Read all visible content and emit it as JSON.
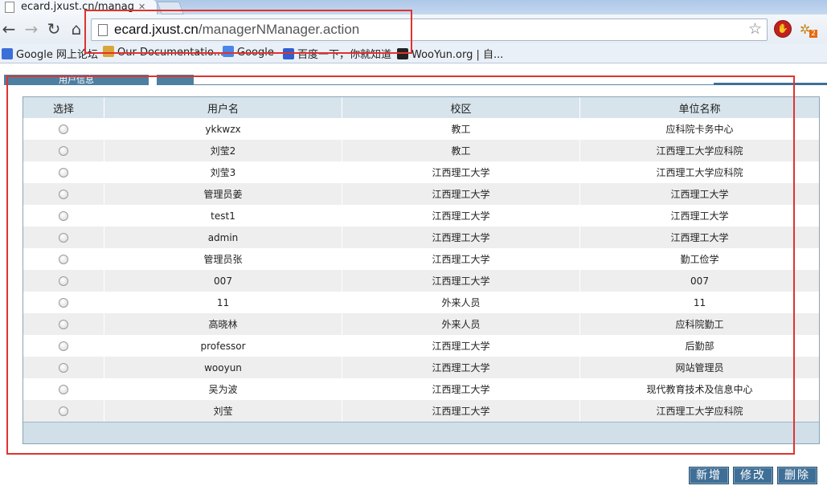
{
  "browser": {
    "tab_title": "ecard.jxust.cn/manager",
    "url_host": "ecard.jxust.cn",
    "url_path": "/managerNManager.action",
    "ext_badge": "2",
    "bookmarks": [
      {
        "label": "Google 网上论坛",
        "color": "#3b6fd8"
      },
      {
        "label": "Our Documentatio...",
        "color": "#d8a53b"
      },
      {
        "label": "Google",
        "color": "#4a86e8"
      },
      {
        "label": "百度一下，你就知道",
        "color": "#2f5fd0"
      },
      {
        "label": "WooYun.org | 自...",
        "color": "#222222"
      }
    ]
  },
  "panel": {
    "tab_users": "用户信息",
    "tab_second": ""
  },
  "table": {
    "headers": [
      "选择",
      "用户名",
      "校区",
      "单位名称"
    ],
    "rows": [
      {
        "username": "ykkwzx",
        "campus": "教工",
        "unit": "应科院卡务中心"
      },
      {
        "username": "刘莹2",
        "campus": "教工",
        "unit": "江西理工大学应科院"
      },
      {
        "username": "刘莹3",
        "campus": "江西理工大学",
        "unit": "江西理工大学应科院"
      },
      {
        "username": "管理员姜",
        "campus": "江西理工大学",
        "unit": "江西理工大学"
      },
      {
        "username": "test1",
        "campus": "江西理工大学",
        "unit": "江西理工大学"
      },
      {
        "username": "admin",
        "campus": "江西理工大学",
        "unit": "江西理工大学"
      },
      {
        "username": "管理员张",
        "campus": "江西理工大学",
        "unit": "勤工俭学"
      },
      {
        "username": "007",
        "campus": "江西理工大学",
        "unit": "007"
      },
      {
        "username": "11",
        "campus": "外来人员",
        "unit": "11"
      },
      {
        "username": "高晓林",
        "campus": "外来人员",
        "unit": "应科院勤工"
      },
      {
        "username": "professor",
        "campus": "江西理工大学",
        "unit": "后勤部"
      },
      {
        "username": "wooyun",
        "campus": "江西理工大学",
        "unit": "网站管理员"
      },
      {
        "username": "吴为波",
        "campus": "江西理工大学",
        "unit": "现代教育技术及信息中心"
      },
      {
        "username": "刘莹",
        "campus": "江西理工大学",
        "unit": "江西理工大学应科院"
      }
    ]
  },
  "actions": {
    "add": "新增",
    "edit": "修改",
    "delete": "删除"
  },
  "colors": {
    "highlight": "#e0332e",
    "header_bg": "#d8e4ec",
    "button_bg": "#3f6f96"
  }
}
